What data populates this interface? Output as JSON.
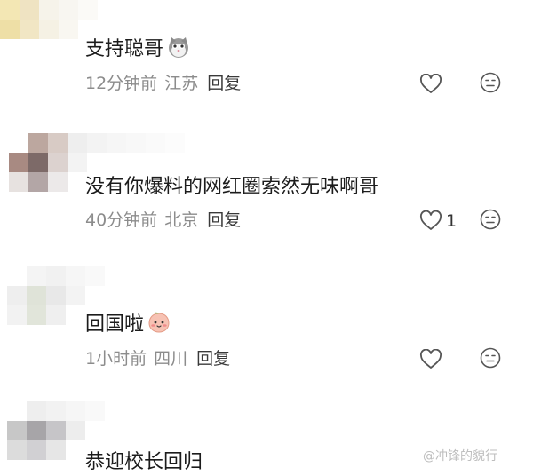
{
  "comments": [
    {
      "text": "支持聪哥",
      "emoji": "cat-face-icon",
      "time": "12分钟前",
      "location": "江苏",
      "reply_label": "回复",
      "likes": ""
    },
    {
      "text": "没有你爆料的网红圈索然无味啊哥",
      "emoji": "",
      "time": "40分钟前",
      "location": "北京",
      "reply_label": "回复",
      "likes": "1"
    },
    {
      "text": "回国啦",
      "emoji": "peach-blush-face-icon",
      "time": "1小时前",
      "location": "四川",
      "reply_label": "回复",
      "likes": ""
    },
    {
      "text": "恭迎校长回归",
      "emoji": "",
      "time": "",
      "location": "",
      "reply_label": "",
      "likes": ""
    }
  ],
  "watermark": "@冲锋的貌行",
  "colors": {
    "meta_gray": "#8c8c8c",
    "icon_gray": "#555555",
    "text": "#1c1c1c"
  }
}
